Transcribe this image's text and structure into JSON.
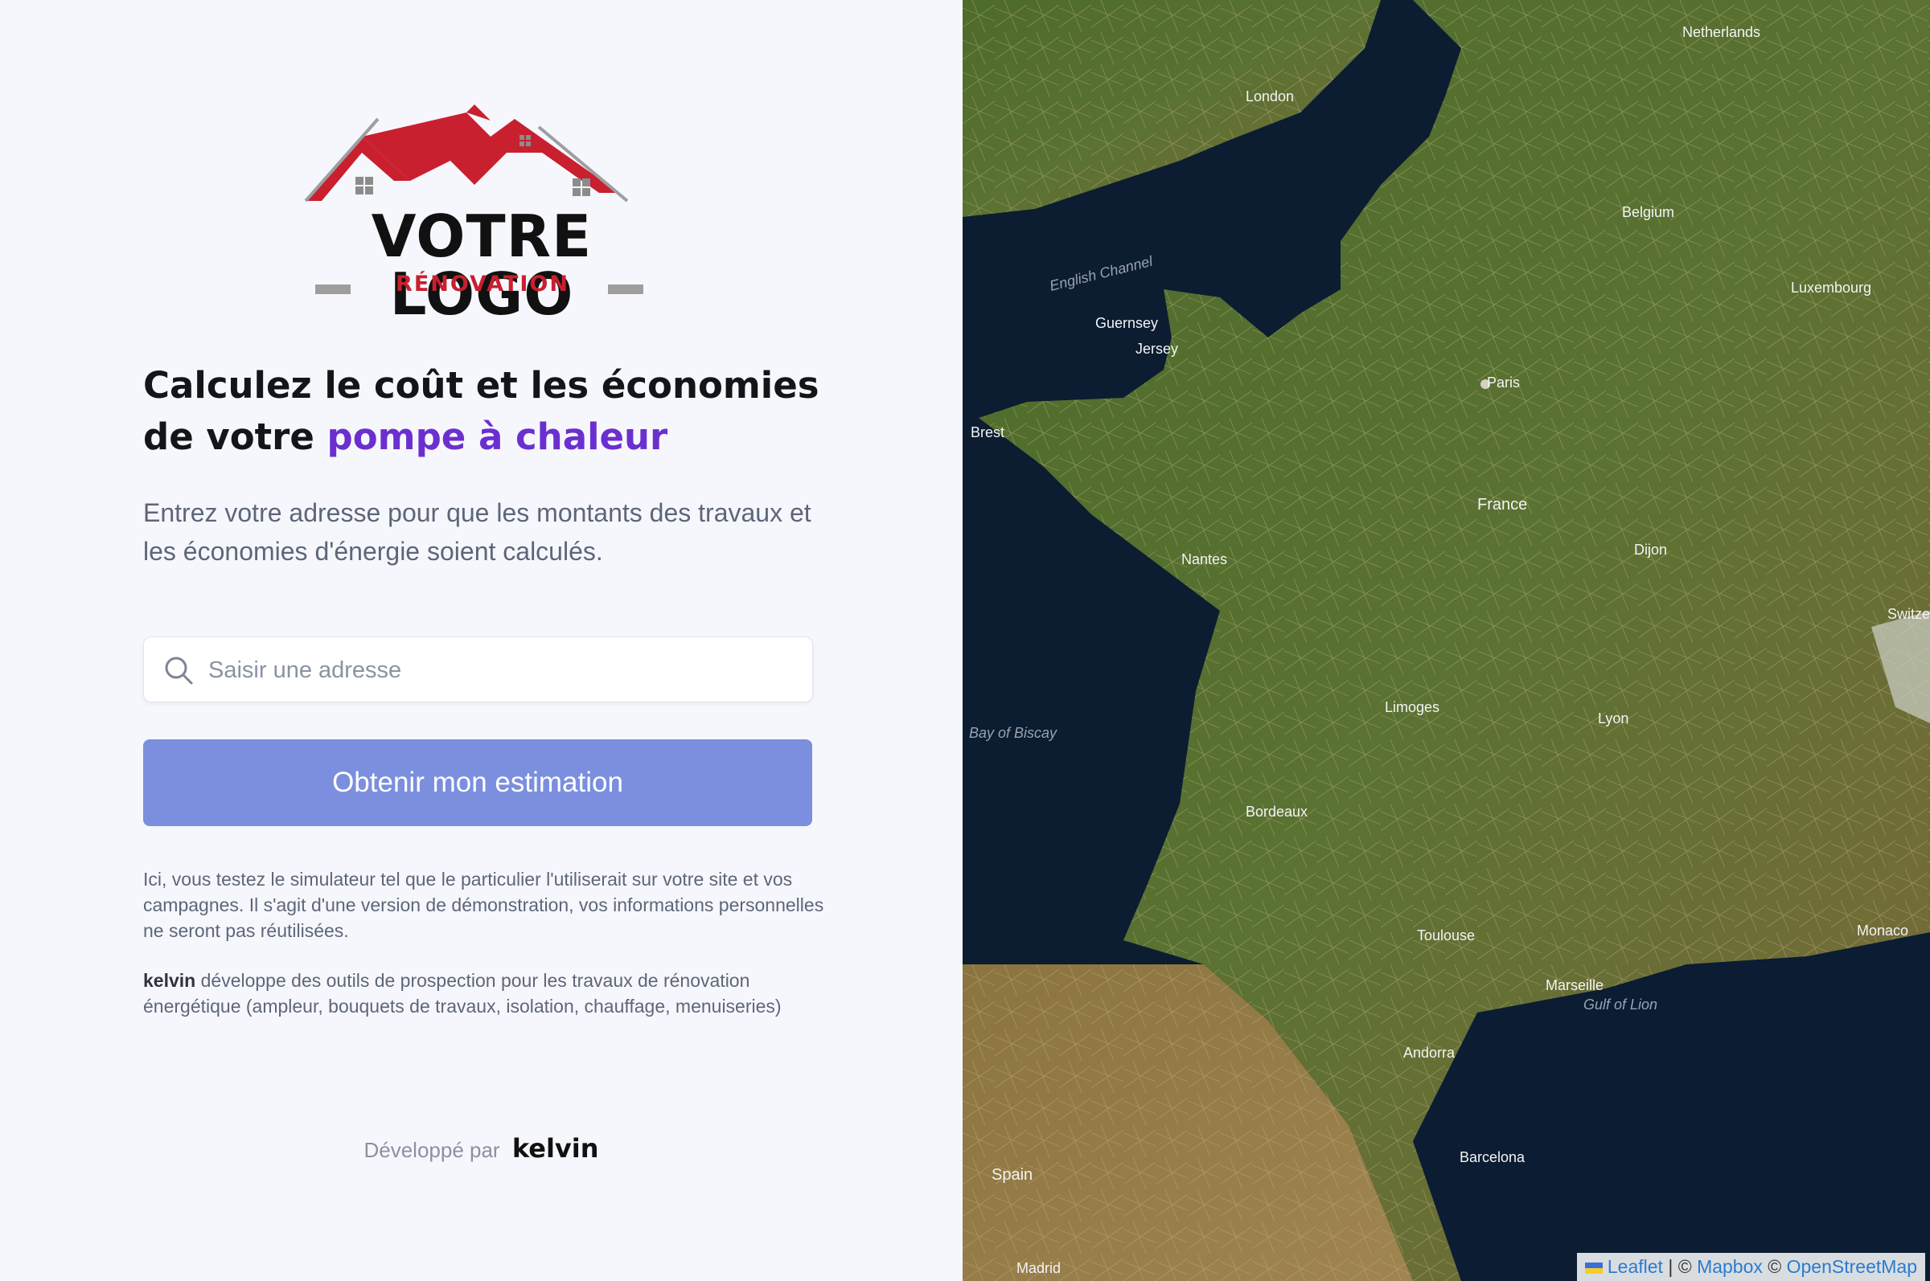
{
  "logo": {
    "text": "VOTRE LOGO",
    "subtext": "RÉNOVATION",
    "colors": {
      "roof": "#c8202f",
      "text": "#111111",
      "bar": "#9e9e9e"
    }
  },
  "heading": {
    "line1": "Calculez le coût et les économies",
    "line2_prefix": "de votre ",
    "line2_accent": "pompe à chaleur"
  },
  "intro": "Entrez votre adresse pour que les montants des travaux et les économies d'énergie soient calculés.",
  "search": {
    "placeholder": "Saisir une adresse",
    "value": "",
    "icon": "search-icon"
  },
  "cta": {
    "label": "Obtenir mon estimation",
    "color": "#7b8fde"
  },
  "disclaimer": "Ici, vous testez le simulateur tel que le particulier l'utiliserait sur votre site et vos campagnes. Il s'agit d'une version de démonstration, vos informations personnelles ne seront pas réutilisées.",
  "about": {
    "brand": "kelvin",
    "text": " développe des outils de prospection pour les travaux de rénovation énergétique (ampleur, bouquets de travaux, isolation, chauffage, menuiseries)"
  },
  "footer": {
    "label": "Développé par",
    "brand": "kelvin"
  },
  "map": {
    "labels": [
      "Netherlands",
      "London",
      "Belgium",
      "Paris",
      "France",
      "Luxembourg",
      "Switzerl",
      "Spain",
      "Andorra",
      "Marseille",
      "Bordeaux",
      "Nantes",
      "Lyon",
      "Toulouse",
      "Barcelona",
      "Brest",
      "Dijon",
      "Limoges",
      "Jersey",
      "Guernsey",
      "Monaco",
      "Madrid",
      "English Channel",
      "Bay of Biscay",
      "Gulf of Lion"
    ],
    "attribution": {
      "leaflet": "Leaflet",
      "mapbox": "Mapbox",
      "osm": "OpenStreetMap",
      "copyright": "©"
    }
  }
}
